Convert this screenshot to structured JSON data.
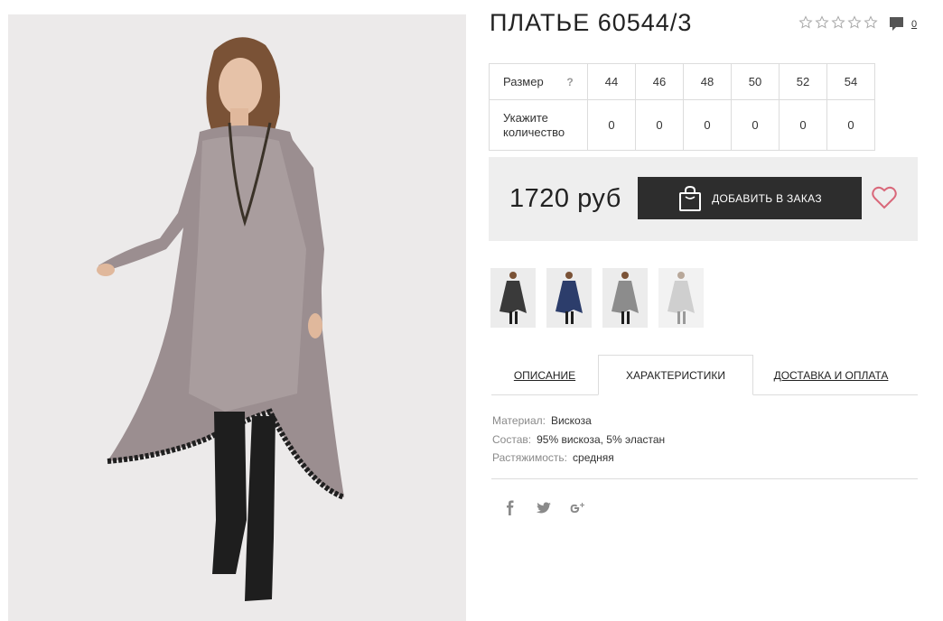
{
  "product": {
    "title": "ПЛАТЬЕ 60544/3",
    "rating_stars": 5,
    "rating_value": 0,
    "comments_count": "0"
  },
  "sizes": {
    "size_label": "Размер",
    "help_mark": "?",
    "qty_label": "Укажите количество",
    "values": [
      "44",
      "46",
      "48",
      "50",
      "52",
      "54"
    ],
    "quantities": [
      "0",
      "0",
      "0",
      "0",
      "0",
      "0"
    ]
  },
  "buy": {
    "price": "1720 руб",
    "add_label": "ДОБАВИТЬ В ЗАКАЗ"
  },
  "thumbnails": [
    {
      "color": "#3a3a3a"
    },
    {
      "color": "#2c3d6b"
    },
    {
      "color": "#8c8c8c"
    },
    {
      "color": "#c9c9c9"
    }
  ],
  "tabs": [
    {
      "label": "ОПИСАНИЕ"
    },
    {
      "label": "ХАРАКТЕРИСТИКИ"
    },
    {
      "label": "ДОСТАВКА И ОПЛАТА"
    }
  ],
  "specs": [
    {
      "key": "Материал:",
      "value": "Вискоза"
    },
    {
      "key": "Состав:",
      "value": "95% вискоза, 5% эластан"
    },
    {
      "key": "Растяжимость:",
      "value": "средняя"
    }
  ],
  "social": [
    {
      "icon": "facebook-icon",
      "glyph": "f"
    },
    {
      "icon": "twitter-icon",
      "glyph": "t"
    },
    {
      "icon": "google-plus-icon",
      "glyph": "g+"
    }
  ],
  "colors": {
    "button_bg": "#2d2d2d",
    "heart": "#d9687a",
    "buybox_bg": "#eeeeee"
  }
}
